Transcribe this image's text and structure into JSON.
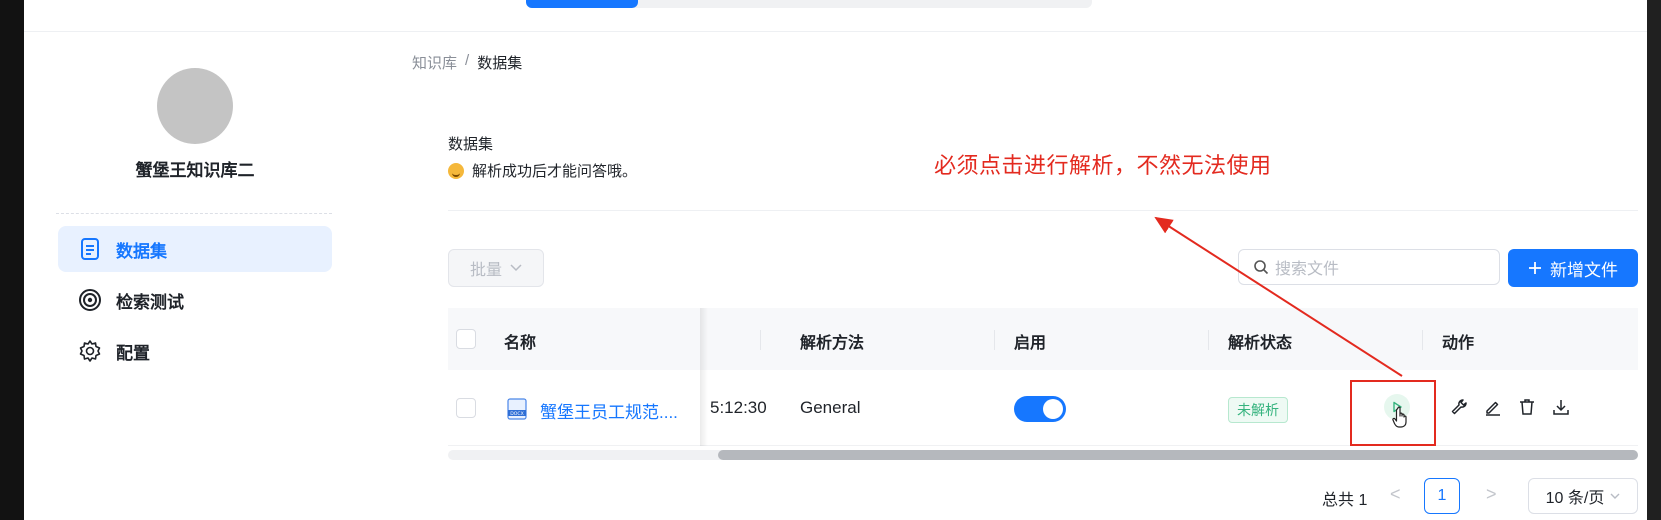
{
  "sidebar": {
    "kb_name": "蟹堡王知识库二",
    "items": [
      {
        "label": "数据集",
        "icon": "document-icon",
        "active": true
      },
      {
        "label": "检索测试",
        "icon": "target-icon",
        "active": false
      },
      {
        "label": "配置",
        "icon": "gear-icon",
        "active": false
      }
    ]
  },
  "breadcrumb": {
    "parent": "知识库",
    "separator": "/",
    "current": "数据集"
  },
  "dataset": {
    "title": "数据集",
    "hint": "解析成功后才能问答哦。"
  },
  "annotation": {
    "text": "必须点击进行解析，不然无法使用",
    "color": "#e32a1f"
  },
  "toolbar": {
    "batch_label": "批量",
    "search_placeholder": "搜索文件",
    "add_label": "新增文件"
  },
  "table": {
    "columns": [
      "名称",
      "解析方法",
      "启用",
      "解析状态",
      "动作"
    ],
    "rows": [
      {
        "name": "蟹堡王员工规范....",
        "time_fragment": "5:12:30",
        "method": "General",
        "enabled": true,
        "status": "未解析"
      }
    ],
    "scroll_position": 0.23
  },
  "pagination": {
    "total_label": "总共 1",
    "current_page": "1",
    "page_size": "10 条/页"
  },
  "colors": {
    "accent": "#1677ff",
    "annotation": "#e32a1f",
    "status_green": "#35b37e"
  }
}
